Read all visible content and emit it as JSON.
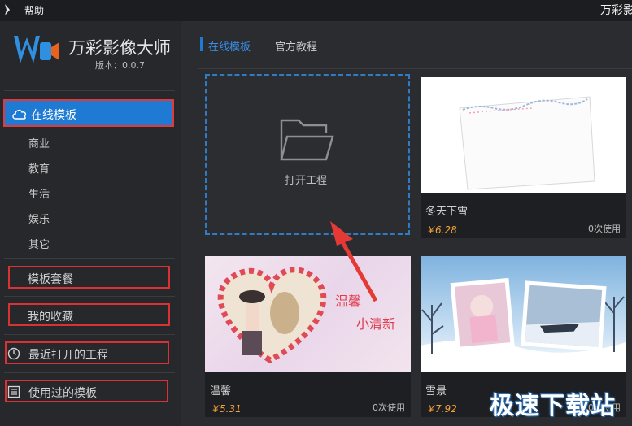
{
  "titlebar": {
    "menu_help": "帮助",
    "app_title": "万彩影"
  },
  "sidebar": {
    "app_name": "万彩影像大师",
    "version": "版本：0.0.7",
    "online_templates": "在线模板",
    "categories": [
      "商业",
      "教育",
      "生活",
      "娱乐",
      "其它"
    ],
    "template_packages": "模板套餐",
    "my_favorites": "我的收藏",
    "recent_projects": "最近打开的工程",
    "used_templates": "使用过的模板"
  },
  "tabs": {
    "online": "在线模板",
    "docs": "官方教程"
  },
  "open_project": {
    "label": "打开工程"
  },
  "cards": [
    {
      "title": "冬天下雪",
      "price": "￥6.28",
      "uses": "0次使用"
    },
    {
      "title": "温馨",
      "price": "￥5.31",
      "uses": "0次使用",
      "overlay1": "温馨",
      "overlay2": "小清新"
    },
    {
      "title": "雪景",
      "price": "￥7.92",
      "uses": "0次使用"
    }
  ],
  "watermark": "极速下载站",
  "colors": {
    "accent": "#1f7ad3",
    "highlight_border": "#e03a3a",
    "price": "#f0a23a"
  }
}
